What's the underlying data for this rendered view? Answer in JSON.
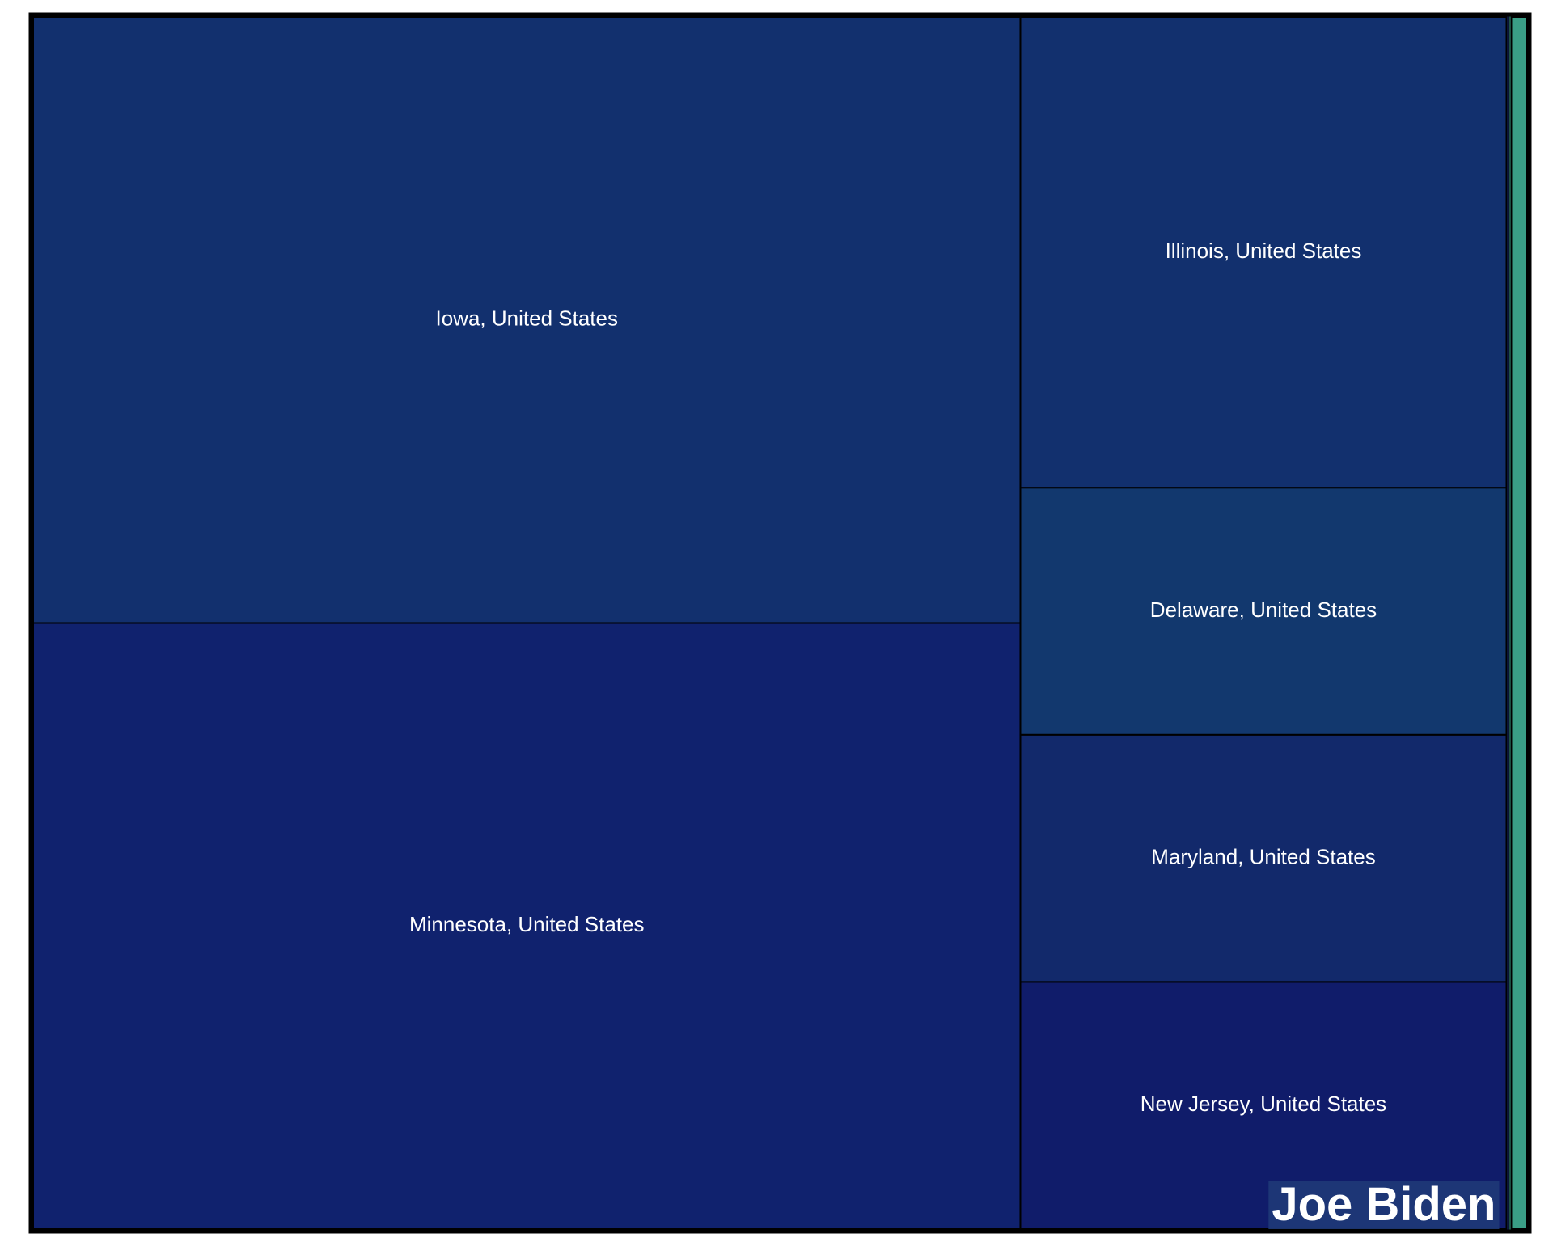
{
  "chart_data": {
    "type": "treemap",
    "title": "",
    "groups": [
      {
        "name": "Joe Biden",
        "color": "#162a6e",
        "items": [
          {
            "label": "Iowa, United States",
            "value": 26.4,
            "color": "#12306e"
          },
          {
            "label": "Minnesota, United States",
            "value": 26.4,
            "color": "#10226e"
          },
          {
            "label": "Illinois, United States",
            "value": 10.1,
            "color": "#12306e"
          },
          {
            "label": "Delaware, United States",
            "value": 5.3,
            "color": "#12386e"
          },
          {
            "label": "Maryland, United States",
            "value": 5.3,
            "color": "#12296b"
          },
          {
            "label": "New Jersey, United States",
            "value": 5.3,
            "color": "#101c6a"
          }
        ]
      },
      {
        "name": "",
        "color": "#3a9e86",
        "items": [
          {
            "label": "",
            "value": 1.1,
            "color": "#3a9e86"
          }
        ]
      }
    ]
  }
}
